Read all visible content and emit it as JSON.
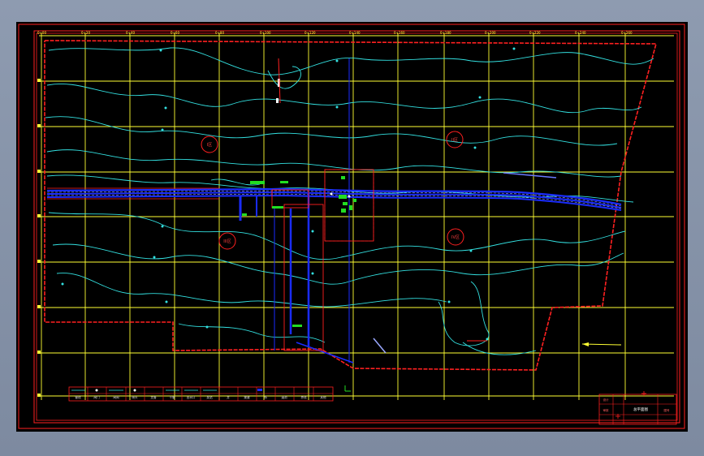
{
  "drawing": {
    "colors": {
      "background": "#000000",
      "viewport": "#8a97ab",
      "border": "#ff2020",
      "grid": "#ffff33",
      "contour": "#33e0e0",
      "pipe": "#1a2cff",
      "equipment": "#22dd22"
    },
    "grid_tick_labels": [
      "0+00",
      "0+20",
      "0+40",
      "0+60",
      "0+80",
      "0+100",
      "0+120",
      "0+140",
      "0+160",
      "0+180",
      "0+200",
      "0+220",
      "0+240",
      "0+260"
    ],
    "zone_labels": [
      "I区",
      "II区",
      "III区",
      "IV区"
    ],
    "legend_items": [
      "管线",
      "阀门",
      "闸阀",
      "喷头",
      "支管",
      "干管",
      "出水口",
      "泵站",
      "井",
      "渠道",
      "桥",
      "涵洞",
      "界线",
      "其他"
    ],
    "title_block": {
      "drawing_name": "总平面图",
      "labels": [
        "设计",
        "审核",
        "图号"
      ]
    }
  }
}
